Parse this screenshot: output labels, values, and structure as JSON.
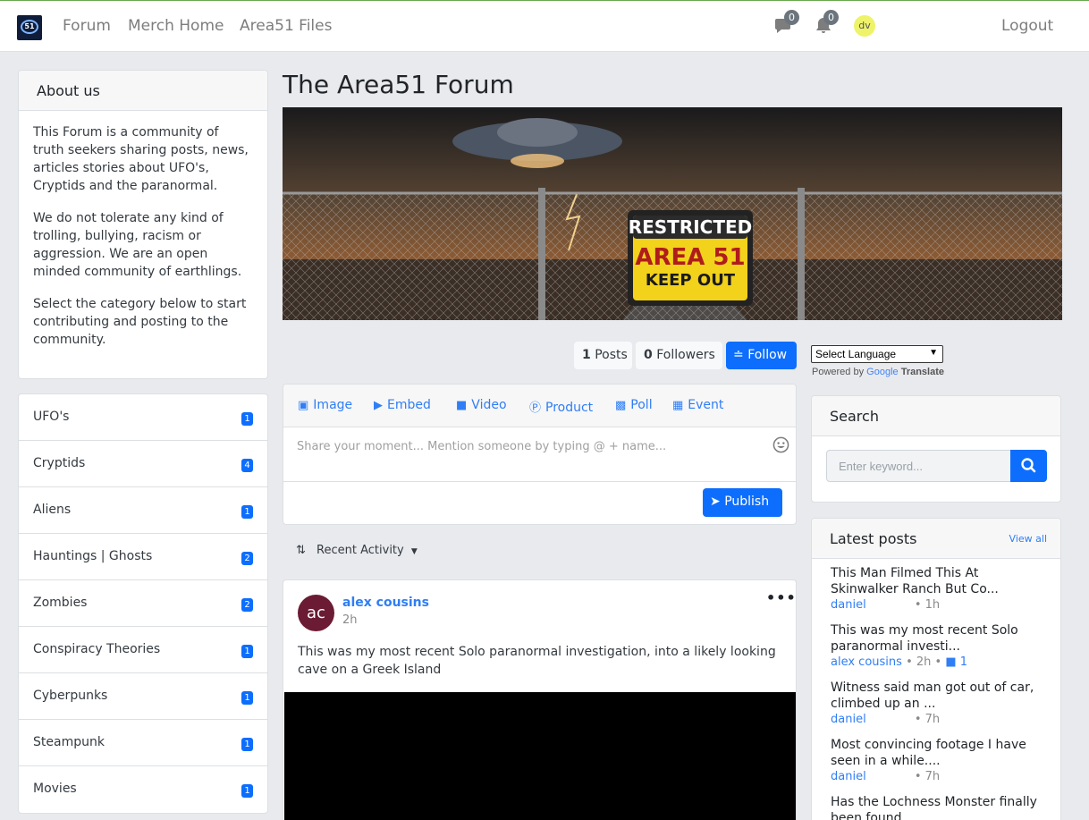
{
  "nav": {
    "logo_text": "51",
    "links": [
      "Forum",
      "Merch Home",
      "Area51 Files"
    ],
    "messages_count": "0",
    "notifications_count": "0",
    "user_initials": "dv",
    "logout": "Logout"
  },
  "about": {
    "title": "About us",
    "paragraphs": [
      "This Forum is a community of truth seekers sharing posts, news, articles stories about UFO's, Cryptids and the paranormal.",
      "We do not tolerate any kind of trolling, bullying, racism or aggression. We are an open minded community of earthlings.",
      "Select the category below to start contributing and posting to the community."
    ]
  },
  "categories": [
    {
      "name": "UFO's",
      "count": "1"
    },
    {
      "name": "Cryptids",
      "count": "4"
    },
    {
      "name": "Aliens",
      "count": "1"
    },
    {
      "name": "Hauntings | Ghosts",
      "count": "2"
    },
    {
      "name": "Zombies",
      "count": "2"
    },
    {
      "name": "Conspiracy Theories",
      "count": "1"
    },
    {
      "name": "Cyberpunks",
      "count": "1"
    },
    {
      "name": "Steampunk",
      "count": "1"
    },
    {
      "name": "Movies",
      "count": "1"
    }
  ],
  "main": {
    "title": "The Area51 Forum",
    "banner": {
      "line1": "RESTRICTED",
      "line2": "AREA 51",
      "line3": "KEEP OUT"
    },
    "posts_count": "1",
    "posts_label": "Posts",
    "followers_count": "0",
    "followers_label": "Followers",
    "follow_label": "Follow"
  },
  "translate": {
    "select_label": "Select Language",
    "powered_by": "Powered by",
    "google": "Google",
    "translate": "Translate"
  },
  "composer": {
    "tabs": [
      "Image",
      "Embed",
      "Video",
      "Product",
      "Poll",
      "Event"
    ],
    "placeholder": "Share your moment... Mention someone by typing @ + name...",
    "publish": "Publish"
  },
  "sort": {
    "label": "Recent Activity"
  },
  "post": {
    "initials": "ac",
    "author": "alex cousins",
    "time": "2h",
    "more": "•••",
    "text": "This was my most recent Solo paranormal investigation, into a likely looking cave on a Greek Island"
  },
  "search": {
    "title": "Search",
    "placeholder": "Enter keyword..."
  },
  "latest": {
    "title": "Latest posts",
    "view_all": "View all",
    "items": [
      {
        "title": "This Man Filmed This At Skinwalker Ranch But Co...",
        "author": "daniel",
        "time": "1h",
        "comments": ""
      },
      {
        "title": "This was my most recent Solo paranormal investi...",
        "author": "alex cousins",
        "time": "2h",
        "comments": "1"
      },
      {
        "title": "Witness said man got out of car, climbed up an ...",
        "author": "daniel",
        "time": "7h",
        "comments": ""
      },
      {
        "title": "Most convincing footage I have seen in a while....",
        "author": "daniel",
        "time": "7h",
        "comments": ""
      },
      {
        "title": "Has the Lochness Monster finally been found",
        "author": "",
        "time": "",
        "comments": ""
      }
    ]
  },
  "colors": {
    "accent": "#0d6efd",
    "link": "#2f7ef5",
    "badge": "#0d6efd",
    "avatar": "#6b1b33"
  }
}
